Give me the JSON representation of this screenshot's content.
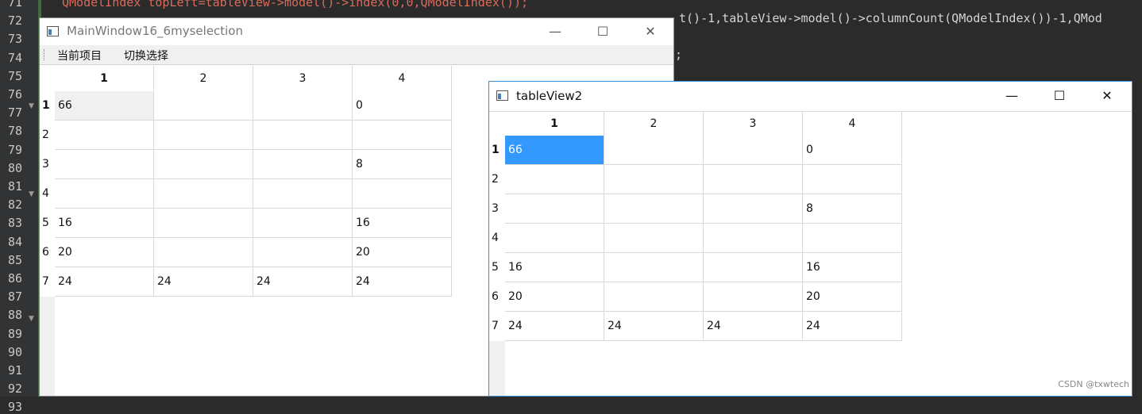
{
  "editor": {
    "line_numbers": [
      "71",
      "72",
      "73",
      "74",
      "75",
      "76",
      "77",
      "78",
      "79",
      "80",
      "81",
      "82",
      "83",
      "84",
      "85",
      "86",
      "87",
      "88",
      "89",
      "90",
      "91",
      "92",
      "93"
    ],
    "line_71": "QModelIndex topLeft=tableView->model()->index(0,0,QModelIndex());",
    "line_72_right": "t()-1,tableView->model()->columnCount(QModelIndex())-1,QMod",
    "line_74_right": ";"
  },
  "main_window": {
    "title": "MainWindow16_6myselection",
    "menu": [
      "当前项目",
      "切换选择"
    ]
  },
  "view_window": {
    "title": "tableView2"
  },
  "controls": {
    "minimize": "—",
    "maximize": "☐",
    "close": "✕"
  },
  "table": {
    "columns": [
      "1",
      "2",
      "3",
      "4"
    ],
    "rows": [
      {
        "header": "1",
        "cells": [
          "66",
          "",
          "",
          "0"
        ]
      },
      {
        "header": "2",
        "cells": [
          "",
          "",
          "",
          ""
        ]
      },
      {
        "header": "3",
        "cells": [
          "",
          "",
          "",
          "8"
        ]
      },
      {
        "header": "4",
        "cells": [
          "",
          "",
          "",
          ""
        ]
      },
      {
        "header": "5",
        "cells": [
          "16",
          "",
          "",
          "16"
        ]
      },
      {
        "header": "6",
        "cells": [
          "20",
          "",
          "",
          "20"
        ]
      },
      {
        "header": "7",
        "cells": [
          "24",
          "24",
          "24",
          "24"
        ]
      }
    ]
  },
  "watermark": "CSDN @txwtech"
}
